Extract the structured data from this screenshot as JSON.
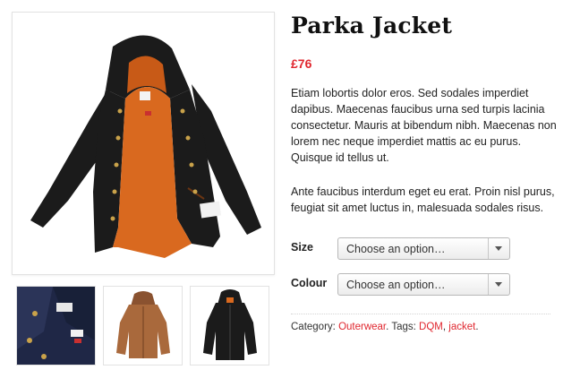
{
  "product": {
    "title": "Parka Jacket",
    "price": "£76",
    "description": [
      "Etiam lobortis dolor eros. Sed sodales imperdiet dapibus. Maecenas faucibus urna sed turpis lacinia consectetur. Mauris at bibendum nibh. Maecenas non lorem nec neque imperdiet mattis ac eu purus. Quisque id tellus ut.",
      "Ante faucibus interdum eget eu erat. Proin nisl purus, feugiat sit amet luctus in, malesuada sodales risus."
    ],
    "options": [
      {
        "label": "Size",
        "placeholder": "Choose an option…"
      },
      {
        "label": "Colour",
        "placeholder": "Choose an option…"
      }
    ],
    "meta": {
      "category_label": "Category:",
      "category": "Outerwear",
      "separator": ".",
      "tags_label": "Tags:",
      "tags": [
        "DQM",
        "jacket"
      ],
      "tag_separator": ",",
      "end": "."
    }
  },
  "colors": {
    "accent": "#e0272f",
    "jacket_black": "#1b1b1b",
    "lining_orange": "#d9691f",
    "navy": "#1f2746",
    "tan": "#a9693c"
  },
  "gallery": {
    "main_image": "parka-jacket-open-orange-lining-photo",
    "thumbnails": [
      "navy-jacket-collar-thumb",
      "tan-parka-thumb",
      "black-parka-thumb"
    ]
  }
}
